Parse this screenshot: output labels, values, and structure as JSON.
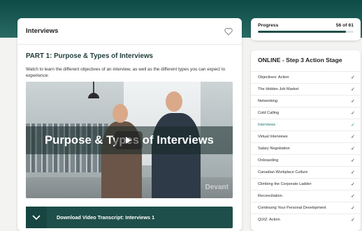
{
  "main": {
    "card_title": "Interviews",
    "section_title": "PART 1:  Purpose & Types of Interviews",
    "section_desc": "Watch to learn the different objectives of an interview, as well as the different types you can expect to experience:",
    "video": {
      "caption": "Purpose & Types of Interviews",
      "watermark": "Devant"
    },
    "transcript_label": "Download Video Transcript: Interviews 1"
  },
  "progress": {
    "label": "Progress",
    "count": "56 of 61",
    "fraction": 0.918
  },
  "steps": {
    "title": "ONLINE - Step 3 Action Stage",
    "items": [
      {
        "label": "Objectives: Action",
        "done": true
      },
      {
        "label": "The Hidden Job Market",
        "done": true
      },
      {
        "label": "Networking",
        "done": true
      },
      {
        "label": "Cold Calling",
        "done": true
      },
      {
        "label": "Interviews",
        "done": true,
        "active": true
      },
      {
        "label": "Virtual Interviews",
        "done": true
      },
      {
        "label": "Salary Negotiation",
        "done": true
      },
      {
        "label": "Onboarding",
        "done": true
      },
      {
        "label": "Canadian Workplace Culture",
        "done": true
      },
      {
        "label": "Climbing the Corporate Ladder",
        "done": true
      },
      {
        "label": "Reconciliation",
        "done": true
      },
      {
        "label": "Continuing Your Personal Development",
        "done": true
      },
      {
        "label": "QUIZ: Action",
        "done": true
      }
    ]
  },
  "colors": {
    "accent": "#1f4f4a",
    "active_step": "#1f7a6c"
  }
}
